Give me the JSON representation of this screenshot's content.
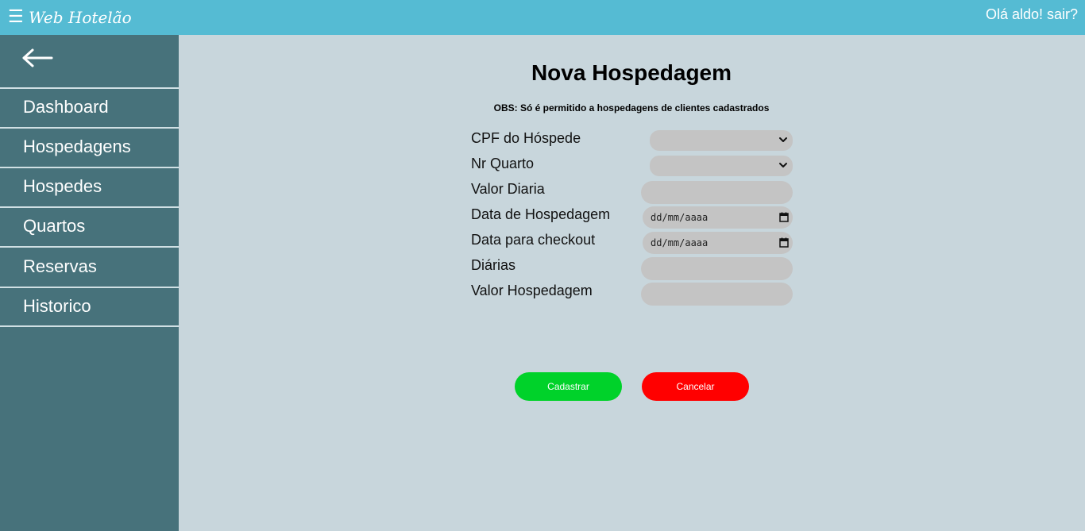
{
  "header": {
    "menu_icon": "hamburger-icon",
    "brand": "Web Hotelão",
    "greeting": "Olá aldo! sair?"
  },
  "sidebar": {
    "back_icon": "arrow-left-icon",
    "items": [
      {
        "label": "Dashboard"
      },
      {
        "label": "Hospedagens"
      },
      {
        "label": "Hospedes"
      },
      {
        "label": "Quartos"
      },
      {
        "label": "Reservas"
      },
      {
        "label": "Historico"
      }
    ]
  },
  "main": {
    "title": "Nova Hospedagem",
    "obs": "OBS: Só é permitido a hospedagens de clientes cadastrados"
  },
  "form": {
    "cpf": {
      "label": "CPF do Hóspede",
      "value": ""
    },
    "quarto": {
      "label": "Nr Quarto",
      "value": ""
    },
    "valor_diaria": {
      "label": "Valor Diaria",
      "value": ""
    },
    "data_hospedagem": {
      "label": "Data de Hospedagem",
      "placeholder": "dd/mm/aaaa"
    },
    "data_checkout": {
      "label": "Data para checkout",
      "placeholder": "dd/mm/aaaa"
    },
    "diarias": {
      "label": "Diárias",
      "value": ""
    },
    "valor_hospedagem": {
      "label": "Valor Hospedagem",
      "value": ""
    }
  },
  "buttons": {
    "cadastrar": "Cadastrar",
    "cancelar": "Cancelar"
  },
  "colors": {
    "topbar": "#55bbd3",
    "sidebar": "#47727b",
    "background": "#c8d6dc",
    "field": "#c4c4c4",
    "cadastrar": "#00d22a",
    "cancelar": "#ff0000"
  }
}
